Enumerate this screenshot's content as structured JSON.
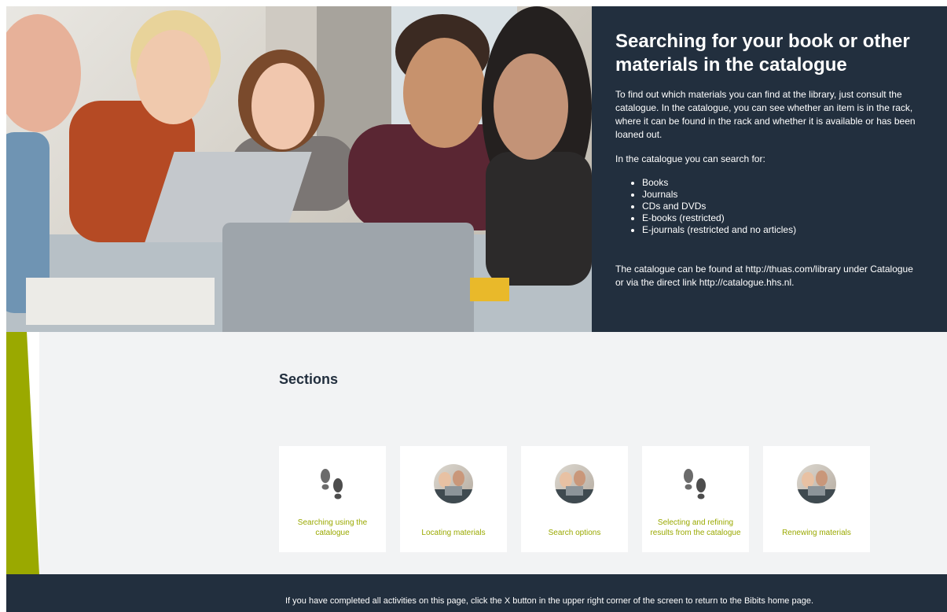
{
  "hero": {
    "title": "Searching for your book or other materials in the catalogue",
    "intro": "To find out which materials you can find at the library, just consult the catalogue. In the catalogue, you can see whether an item is in the rack, where it can be found in the rack and whether it is available or has been loaned out.",
    "list_intro": "In the catalogue you can search for:",
    "items": [
      "Books",
      "Journals",
      "CDs and DVDs",
      "E-books (restricted)",
      "E-journals (restricted and no articles)"
    ],
    "location_text": "The catalogue can be found at http://thuas.com/library under Catalogue or via the direct link http://catalogue.hhs.nl."
  },
  "sections": {
    "title": "Sections",
    "cards": [
      {
        "label": "Searching using the catalogue",
        "icon": "footprints-icon"
      },
      {
        "label": "Locating materials",
        "icon": "students-avatar-icon"
      },
      {
        "label": "Search options",
        "icon": "students-avatar-icon"
      },
      {
        "label": "Selecting and refining results from the catalogue",
        "icon": "footprints-icon"
      },
      {
        "label": "Renewing materials",
        "icon": "students-avatar-icon"
      }
    ]
  },
  "footer": {
    "text": "If you have completed all activities on this page, click the X button in the upper right corner of the screen to return to the Bibits home page."
  },
  "colors": {
    "dark_panel": "#222f3e",
    "accent_green": "#9aa900",
    "section_bg": "#f2f3f4"
  }
}
